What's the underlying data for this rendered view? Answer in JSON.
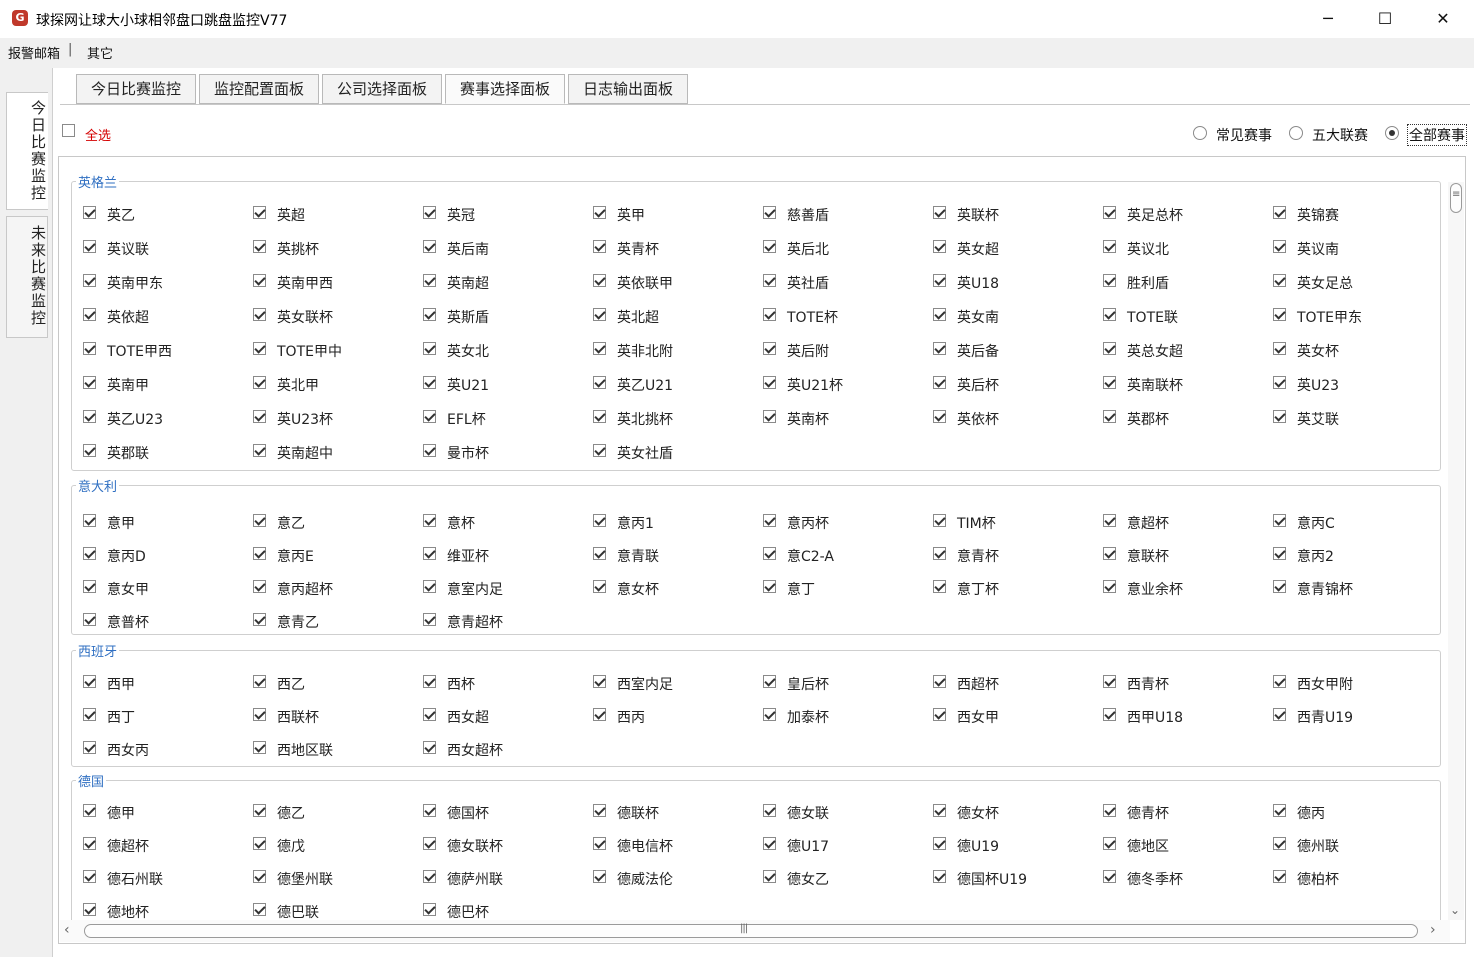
{
  "window": {
    "title": "球探网让球大小球相邻盘口跳盘监控V77",
    "minimize": "─",
    "maximize": "☐",
    "close": "✕"
  },
  "menu": [
    "报警邮箱",
    "其它"
  ],
  "menu_sep": "|",
  "side_tabs": [
    "今日比赛监控",
    "未来比赛监控"
  ],
  "tabs": [
    "今日比赛监控",
    "监控配置面板",
    "公司选择面板",
    "赛事选择面板",
    "日志输出面板"
  ],
  "active_tab": 3,
  "select_all": "全选",
  "filters": [
    "常见赛事",
    "五大联赛",
    "全部赛事"
  ],
  "selected_filter": 2,
  "groups": [
    {
      "title": "英格兰",
      "items": [
        "英乙",
        "英超",
        "英冠",
        "英甲",
        "慈善盾",
        "英联杯",
        "英足总杯",
        "英锦赛",
        "英议联",
        "英挑杯",
        "英后南",
        "英青杯",
        "英后北",
        "英女超",
        "英议北",
        "英议南",
        "英南甲东",
        "英南甲西",
        "英南超",
        "英依联甲",
        "英社盾",
        "英U18",
        "胜利盾",
        "英女足总",
        "英依超",
        "英女联杯",
        "英斯盾",
        "英北超",
        "TOTE杯",
        "英女南",
        "TOTE联",
        "TOTE甲东",
        "TOTE甲西",
        "TOTE甲中",
        "英女北",
        "英非北附",
        "英后附",
        "英后备",
        "英总女超",
        "英女杯",
        "英南甲",
        "英北甲",
        "英U21",
        "英乙U21",
        "英U21杯",
        "英后杯",
        "英南联杯",
        "英U23",
        "英乙U23",
        "英U23杯",
        "EFL杯",
        "英北挑杯",
        "英南杯",
        "英依杯",
        "英郡杯",
        "英艾联",
        "英郡联",
        "英南超中",
        "曼市杯",
        "英女社盾"
      ]
    },
    {
      "title": "意大利",
      "items": [
        "意甲",
        "意乙",
        "意杯",
        "意丙1",
        "意丙杯",
        "TIM杯",
        "意超杯",
        "意丙C",
        "意丙D",
        "意丙E",
        "维亚杯",
        "意青联",
        "意C2-A",
        "意青杯",
        "意联杯",
        "意丙2",
        "意女甲",
        "意丙超杯",
        "意室内足",
        "意女杯",
        "意丁",
        "意丁杯",
        "意业余杯",
        "意青锦杯",
        "意普杯",
        "意青乙",
        "意青超杯"
      ]
    },
    {
      "title": "西班牙",
      "items": [
        "西甲",
        "西乙",
        "西杯",
        "西室内足",
        "皇后杯",
        "西超杯",
        "西青杯",
        "西女甲附",
        "西丁",
        "西联杯",
        "西女超",
        "西丙",
        "加泰杯",
        "西女甲",
        "西甲U18",
        "西青U19",
        "西女丙",
        "西地区联",
        "西女超杯"
      ]
    },
    {
      "title": "德国",
      "items": [
        "德甲",
        "德乙",
        "德国杯",
        "德联杯",
        "德女联",
        "德女杯",
        "德青杯",
        "德丙",
        "德超杯",
        "德戊",
        "德女联杯",
        "德电信杯",
        "德U17",
        "德U19",
        "德地区",
        "德州联",
        "德石州联",
        "德堡州联",
        "德萨州联",
        "德威法伦",
        "德女乙",
        "德国杯U19",
        "德冬季杯",
        "德柏杯",
        "德地杯",
        "德巴联",
        "德巴杯"
      ]
    }
  ]
}
